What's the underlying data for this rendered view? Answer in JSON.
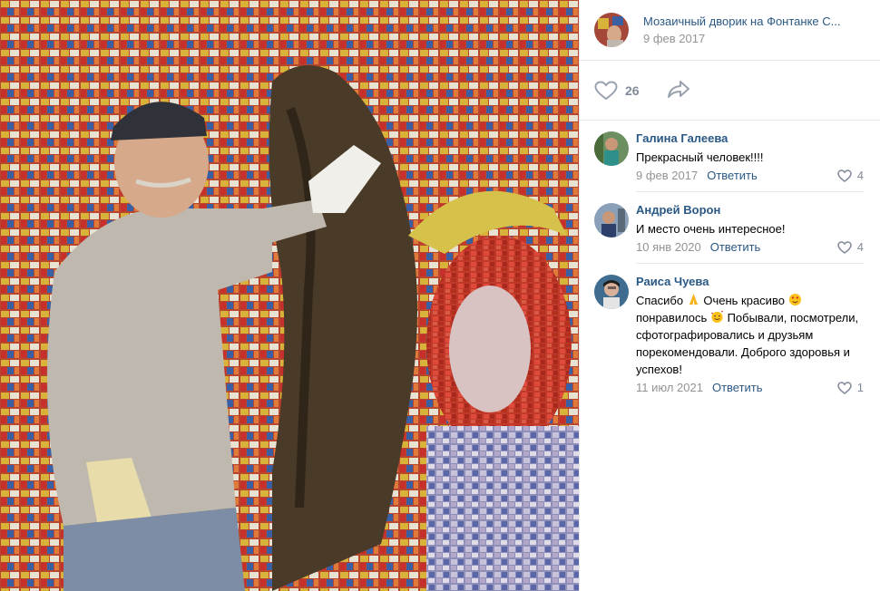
{
  "photo": {
    "alt": "Mosaic wall with man in cap and work gloves"
  },
  "post": {
    "author": "Мозаичный дворик на Фонтанке С...",
    "date": "9 фев 2017",
    "likes": "26",
    "icons": {
      "like": "heart-icon",
      "share": "share-arrow-icon"
    }
  },
  "comments": [
    {
      "name": "Галина Галеева",
      "text": "Прекрасный человек!!!!",
      "date": "9 фев 2017",
      "reply": "Ответить",
      "likes": "4"
    },
    {
      "name": "Андрей Ворон",
      "text": "И место очень интересное!",
      "date": "10 янв 2020",
      "reply": "Ответить",
      "likes": "4"
    },
    {
      "name": "Раиса Чуева",
      "text_parts": [
        "Спасибо",
        "Очень красиво",
        "понравилось",
        "Побывали, посмотрели, сфотографировались и друзьям порекомендовали. Доброго здоровья и успехов!"
      ],
      "date": "11 июл 2021",
      "reply": "Ответить",
      "likes": "1"
    }
  ],
  "colors": {
    "link": "#2a5885",
    "muted": "#939393",
    "count": "#828a99",
    "divider": "#e7e8ec"
  }
}
